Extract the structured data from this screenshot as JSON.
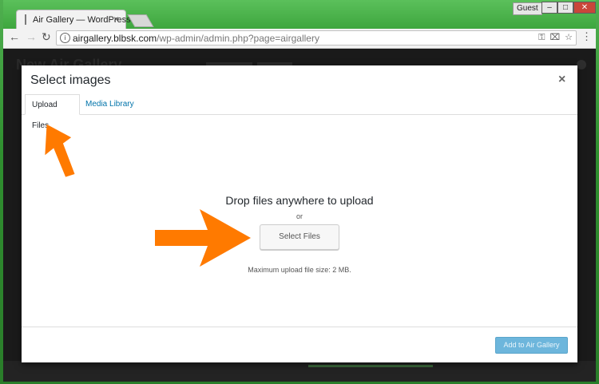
{
  "browser": {
    "tab_title": "Air Gallery — WordPress",
    "tab_close": "×",
    "profile": "Guest",
    "window_minimize": "–",
    "window_maximize": "□",
    "window_close": "✕",
    "url_host": "airgallery.blbsk.com",
    "url_path": "/wp-admin/admin.php?page=airgallery"
  },
  "page": {
    "title": "New Air Gallery"
  },
  "modal": {
    "title": "Select images",
    "close_label": "×",
    "tabs": [
      {
        "label": "Upload Files",
        "active": true
      },
      {
        "label": "Media Library",
        "active": false
      }
    ],
    "drop_text": "Drop files anywhere to upload",
    "or_text": "or",
    "select_button": "Select Files",
    "max_size": "Maximum upload file size: 2 MB.",
    "add_button": "Add to Air Gallery"
  },
  "colors": {
    "link": "#0073aa",
    "arrow": "#ff7a00",
    "primary_button": "#6db6dc"
  },
  "icons": {
    "back": "arrow-left-icon",
    "forward": "arrow-right-icon",
    "reload": "reload-icon",
    "key": "key-icon",
    "translate": "translate-icon",
    "bookmark": "star-icon",
    "menu": "more-vert-icon"
  }
}
